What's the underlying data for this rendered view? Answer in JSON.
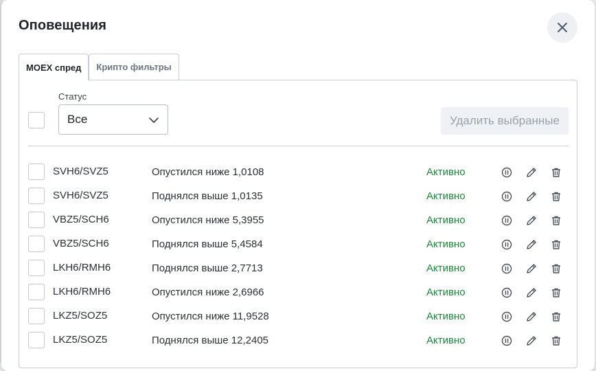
{
  "modal": {
    "title": "Оповещения"
  },
  "tabs": [
    {
      "label": "MOEX спред",
      "active": true
    },
    {
      "label": "Крипто фильтры",
      "active": false
    }
  ],
  "filters": {
    "status_label": "Статус",
    "status_value": "Все",
    "delete_selected_label": "Удалить выбранные"
  },
  "alerts": [
    {
      "pair": "SVH6/SVZ5",
      "condition": "Опустился ниже 1,0108",
      "status": "Активно"
    },
    {
      "pair": "SVH6/SVZ5",
      "condition": "Поднялся выше 1,0135",
      "status": "Активно"
    },
    {
      "pair": "VBZ5/SCH6",
      "condition": "Опустился ниже 5,3955",
      "status": "Активно"
    },
    {
      "pair": "VBZ5/SCH6",
      "condition": "Поднялся выше 5,4584",
      "status": "Активно"
    },
    {
      "pair": "LKH6/RMH6",
      "condition": "Поднялся выше 2,7713",
      "status": "Активно"
    },
    {
      "pair": "LKH6/RMH6",
      "condition": "Опустился ниже 2,6966",
      "status": "Активно"
    },
    {
      "pair": "LKZ5/SOZ5",
      "condition": "Опустился ниже 11,9528",
      "status": "Активно"
    },
    {
      "pair": "LKZ5/SOZ5",
      "condition": "Поднялся выше 12,2405",
      "status": "Активно"
    }
  ],
  "icons": {
    "close": "close-icon",
    "chevron": "chevron-down-icon",
    "pause": "pause-icon",
    "edit": "pencil-icon",
    "delete": "trash-icon"
  },
  "colors": {
    "active_status": "#1a8a3a",
    "border": "#c8cdd3"
  }
}
